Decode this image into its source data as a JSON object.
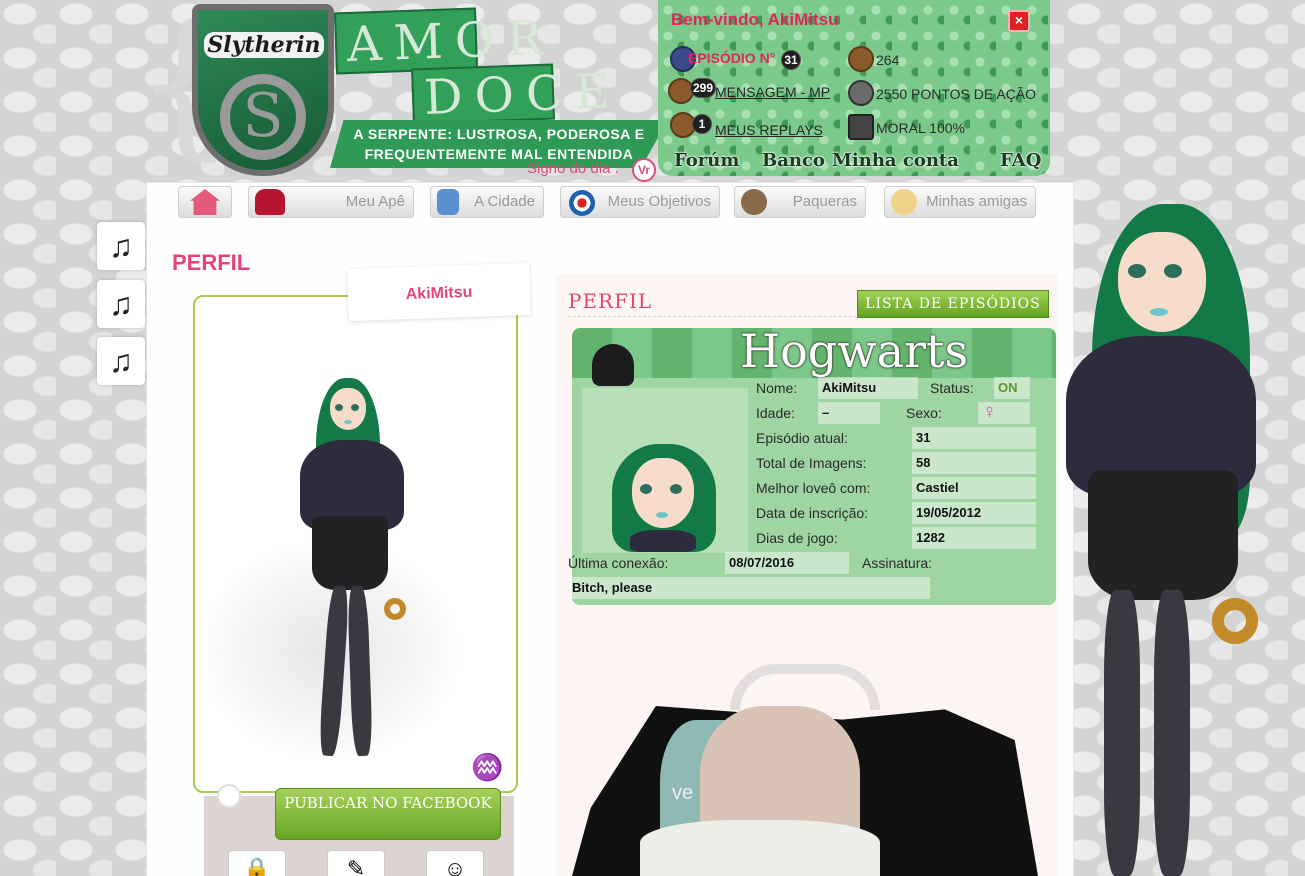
{
  "banner": {
    "crest_title": "Slytherin",
    "crest_letter": "S",
    "title_word1": "AMOR",
    "title_word2": "DOCE",
    "tagline": "A SERPENTE: LUSTROSA, PODEROSA E FREQUENTEMENTE MAL ENTENDIDA",
    "sign_label": "Signo do dia :",
    "sign_badge": "Vr"
  },
  "userbox": {
    "welcome": "Bem-vindo, AkiMitsu",
    "close": "×",
    "episode_label": "EPISÓDIO N°",
    "episode_number": "31",
    "messages_count": "299",
    "messages_link": "MENSAGEM - MP",
    "replays_count": "1",
    "replays_link": "MEUS REPLAYS",
    "coins": "264",
    "action_points": "2550 PONTOS DE AÇÃO",
    "moral": "MORAL 100%",
    "nav": [
      "Forúm",
      "Banco",
      "Minha conta",
      "FAQ"
    ]
  },
  "tabs": [
    {
      "label": ""
    },
    {
      "label": "Meu Apê"
    },
    {
      "label": "A Cidade"
    },
    {
      "label": "Meus Objetivos"
    },
    {
      "label": "Paqueras"
    },
    {
      "label": "Minhas amigas"
    }
  ],
  "music_icon": "♫",
  "page_title": "PERFIL",
  "avatar": {
    "name": "AkiMitsu",
    "zodiac_symbol": "♒",
    "facebook_button": "PUBLICAR NO FACEBOOK"
  },
  "profile": {
    "header": "PERFIL",
    "episodes_button": "LISTA DE EPISÓDIOS",
    "card_title": "Hogwarts",
    "labels": {
      "name": "Nome:",
      "status": "Status:",
      "age": "Idade:",
      "sex": "Sexo:",
      "current_episode": "Episódio atual:",
      "total_images": "Total de Imagens:",
      "best_love": "Melhor loveô com:",
      "signup_date": "Data de inscrição:",
      "play_days": "Dias de jogo:",
      "last_connection": "Última conexão:",
      "signature": "Assinatura:"
    },
    "values": {
      "name": "AkiMitsu",
      "status": "ON",
      "age": "–",
      "sex_symbol": "♀",
      "current_episode": "31",
      "total_images": "58",
      "best_love": "Castiel",
      "signup_date": "19/05/2012",
      "play_days": "1282",
      "last_connection": "08/07/2016",
      "signature": "Bitch, please"
    }
  },
  "collage_text": "ve",
  "colors": {
    "accent_pink": "#e3457a",
    "slytherin_green": "#2f9a56",
    "button_green": "#68a625"
  }
}
